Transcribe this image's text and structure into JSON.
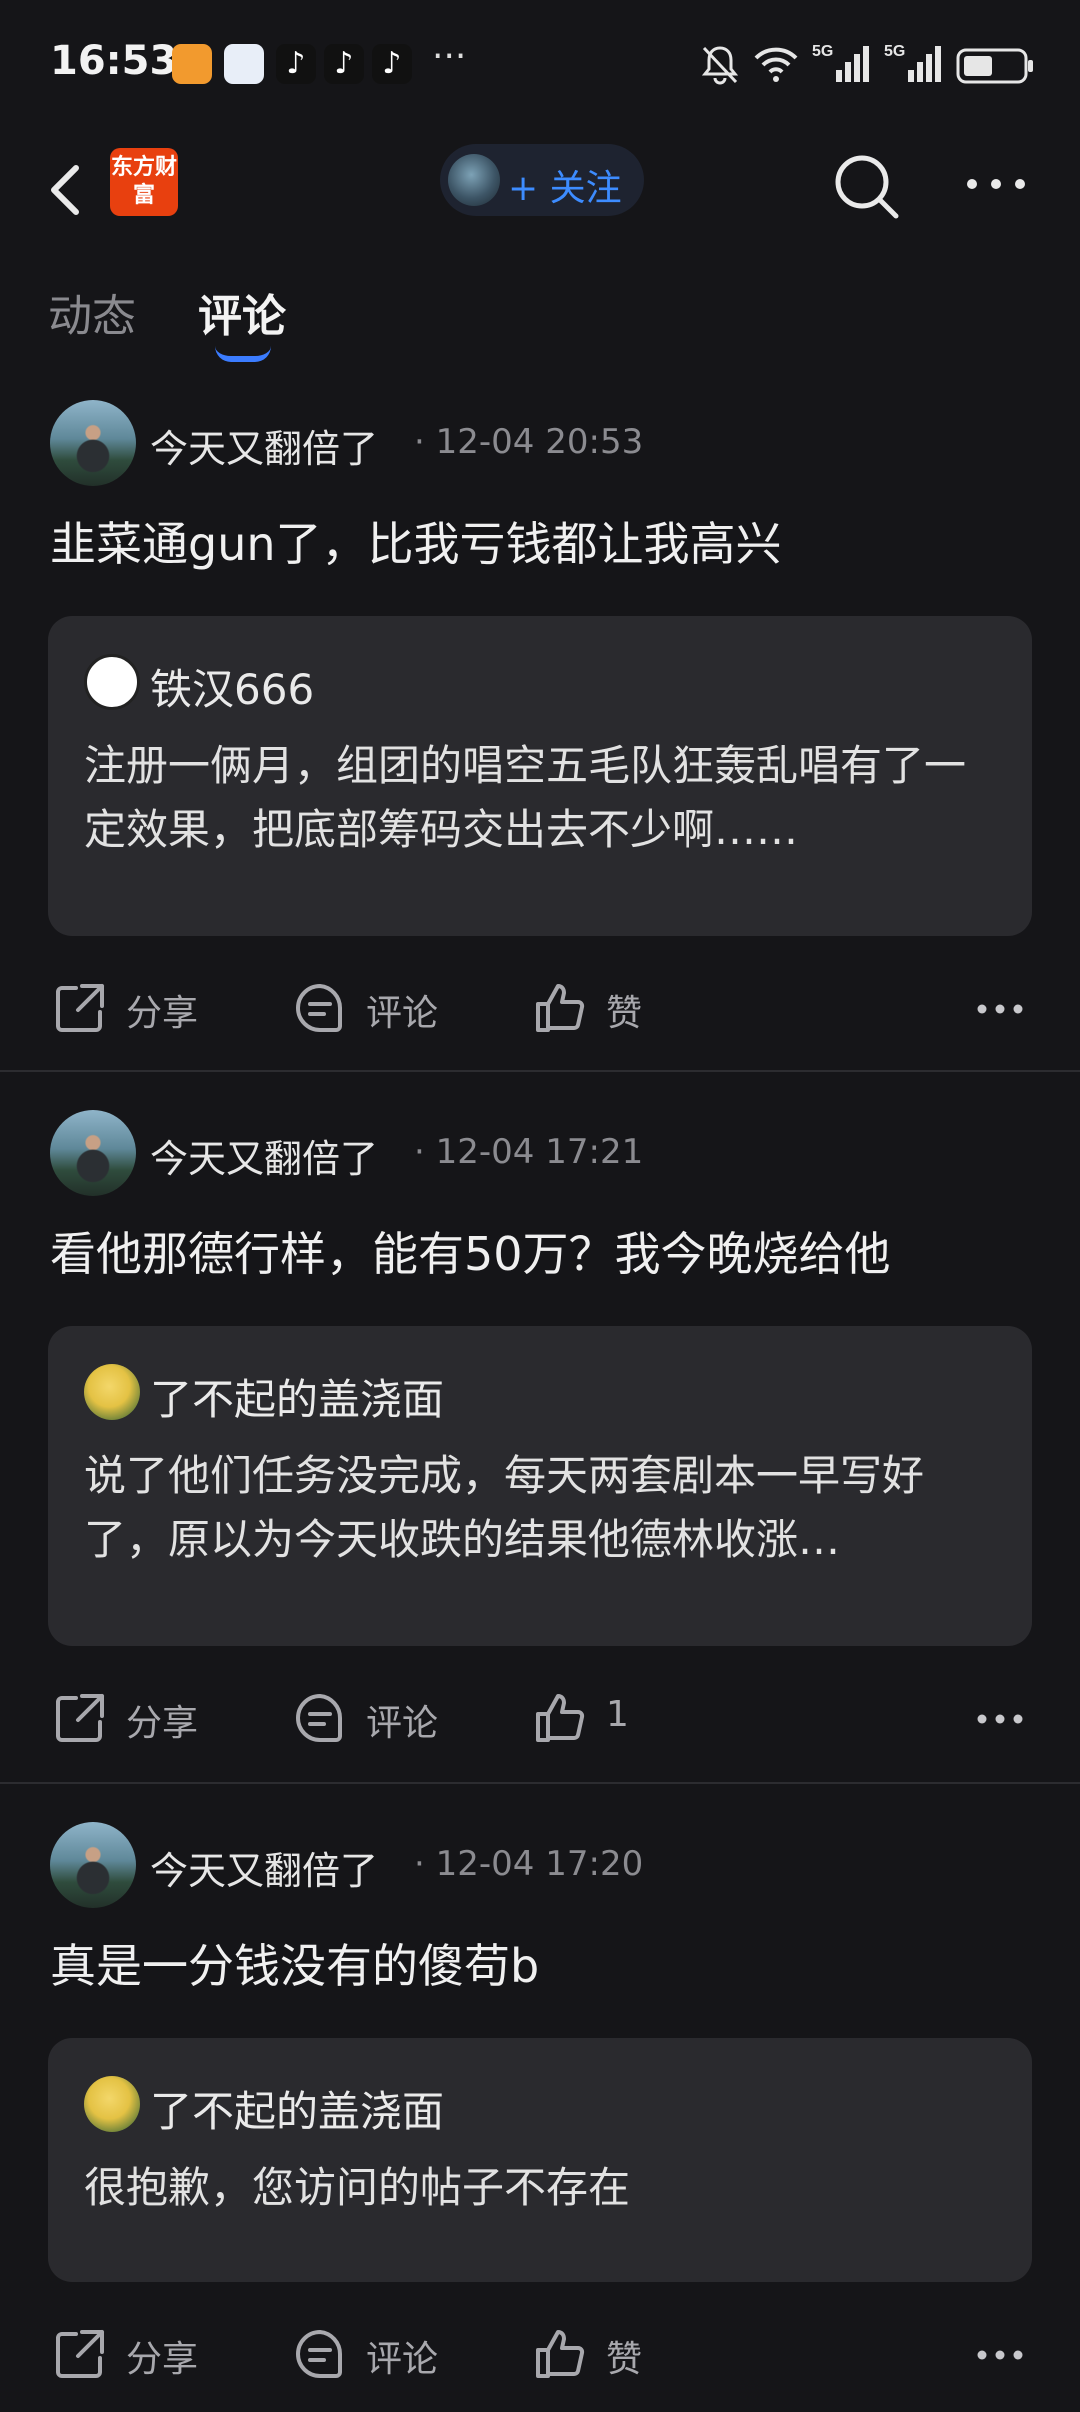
{
  "status_bar": {
    "time": "16:53",
    "app_icons": [
      "app-icon",
      "app-icon",
      "tiktok-icon",
      "tiktok-icon",
      "tiktok-icon"
    ],
    "overflow": "···",
    "right_icons": [
      "mute-bell-icon",
      "wifi-icon",
      "signal-5g-icon",
      "signal-5g-icon",
      "battery-icon"
    ],
    "network_label": "5G"
  },
  "nav": {
    "logo_text": "东方财富",
    "follow_label": "+ 关注"
  },
  "tabs": [
    {
      "label": "动态",
      "active": false
    },
    {
      "label": "评论",
      "active": true
    }
  ],
  "posts": [
    {
      "username": "今天又翻倍了",
      "time": "· 12-04 20:53",
      "content": "韭菜通gun了，比我亏钱都让我高兴",
      "quote": {
        "author": "铁汉666",
        "avatar": "qq-penguin-icon",
        "text": "注册一俩月，组团的唱空五毛队狂轰乱唱有了一定效果，把底部筹码交出去不少啊……"
      },
      "actions": {
        "share": "分享",
        "comment": "评论",
        "like": "赞"
      }
    },
    {
      "username": "今天又翻倍了",
      "time": "· 12-04 17:21",
      "content": "看他那德行样，能有50万？我今晚烧给他",
      "quote": {
        "author": "了不起的盖浇面",
        "avatar": "duck-avatar",
        "text": "说了他们任务没完成，每天两套剧本一早写好了，原以为今天收跌的结果他德林收涨…"
      },
      "actions": {
        "share": "分享",
        "comment": "评论",
        "like": "1"
      }
    },
    {
      "username": "今天又翻倍了",
      "time": "· 12-04 17:20",
      "content": "真是一分钱没有的傻苟b",
      "quote": {
        "author": "了不起的盖浇面",
        "avatar": "duck-avatar",
        "text": "很抱歉，您访问的帖子不存在"
      },
      "actions": {
        "share": "分享",
        "comment": "评论",
        "like": "赞"
      }
    }
  ],
  "colors": {
    "background": "#151518",
    "card": "#2a2a2e",
    "accent_blue": "#3b7cff",
    "logo_orange": "#e8400f"
  }
}
